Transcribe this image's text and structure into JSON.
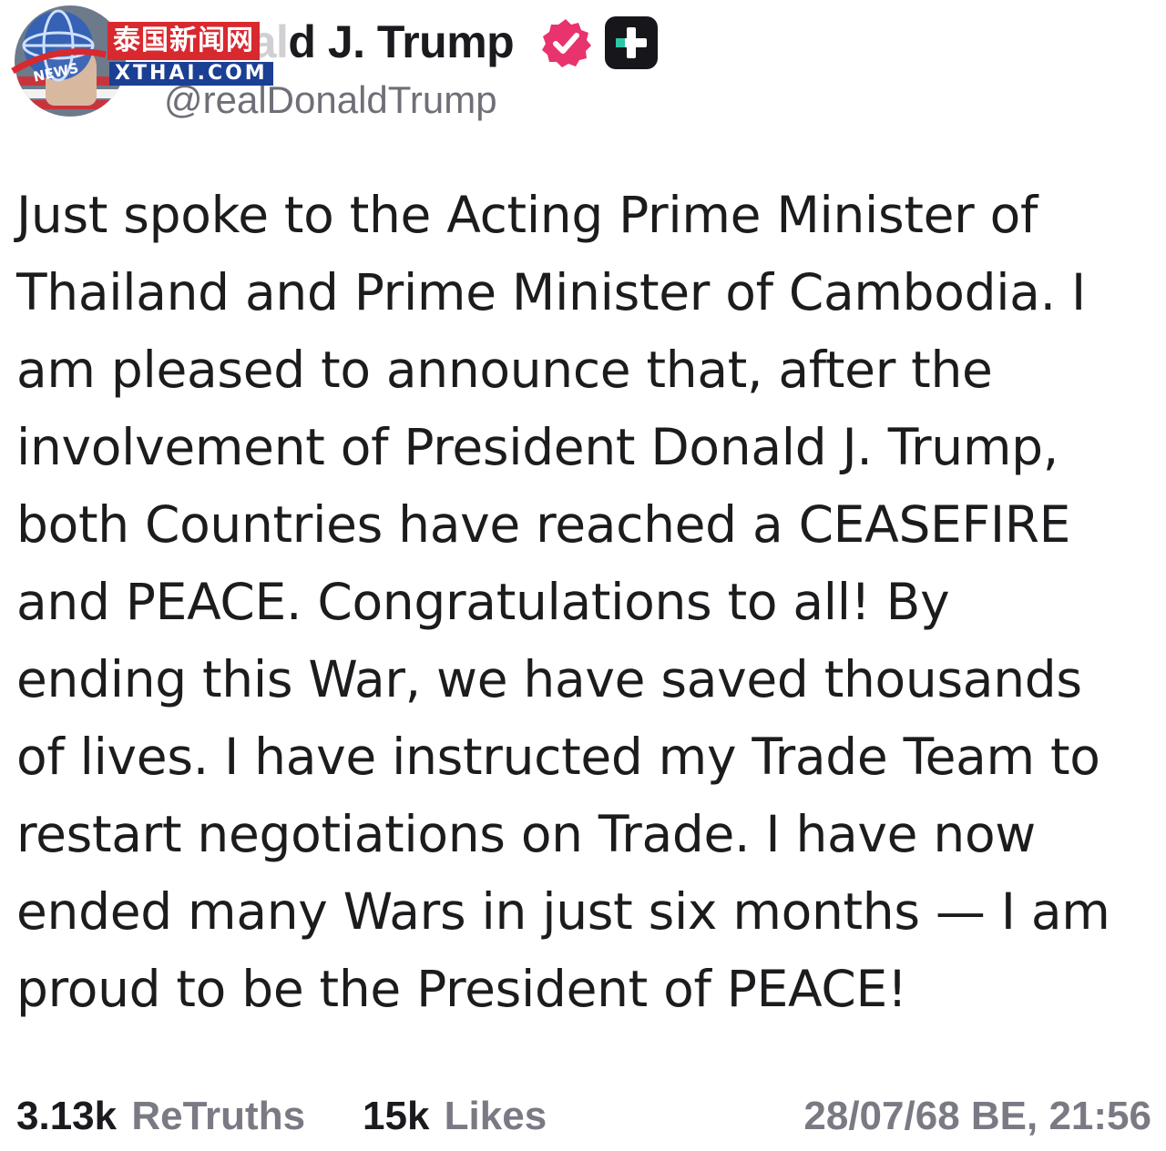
{
  "post": {
    "display_name": "Donald J. Trump",
    "display_name_visible": "d J. Trump",
    "handle": "@realDonaldTrump",
    "verified_icon": "verified-badge-icon",
    "plus_icon": "plus-badge-icon",
    "body_lines": [
      "Just spoke to the Acting Prime Minister of",
      "Thailand and Prime Minister of Cambodia. I",
      "am pleased to announce that, after the",
      "involvement of President Donald J. Trump,",
      "both Countries have reached a CEASEFIRE",
      "and PEACE. Congratulations to all! By",
      "ending this War, we have saved thousands",
      "of lives. I have instructed my Trade Team to",
      "restart negotiations on Trade. I have now",
      "ended many Wars in just six months — I am",
      "proud to be the President of PEACE!"
    ]
  },
  "stats": {
    "retruths_count": "3.13k",
    "retruths_label": "ReTruths",
    "likes_count": "15k",
    "likes_label": "Likes",
    "timestamp": "28/07/68 BE, 21:56"
  },
  "watermark": {
    "chinese_text": "泰国新闻网",
    "site_text": "XTHAI.COM",
    "globe_text": "NEWS"
  },
  "colors": {
    "verified": "#e8336d",
    "text": "#1c1c1f",
    "muted": "#7a7a84",
    "watermark_red": "#d8292f",
    "watermark_blue": "#1b3f93"
  }
}
